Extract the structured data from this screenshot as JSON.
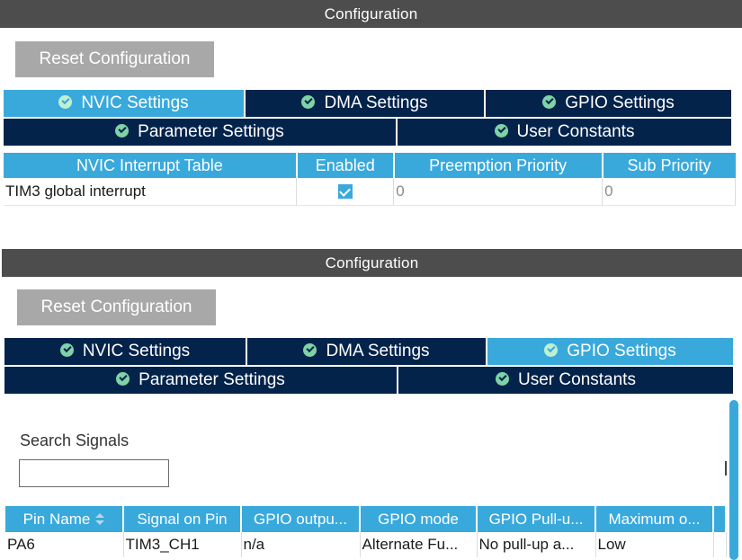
{
  "top_panel": {
    "title": "Configuration",
    "reset_label": "Reset Configuration",
    "tabs_row1": [
      {
        "label": "NVIC Settings",
        "active": true
      },
      {
        "label": "DMA Settings",
        "active": false
      },
      {
        "label": "GPIO Settings",
        "active": false
      }
    ],
    "tabs_row2": [
      {
        "label": "Parameter Settings"
      },
      {
        "label": "User Constants"
      }
    ],
    "nvic_table": {
      "headers": [
        "NVIC Interrupt Table",
        "Enabled",
        "Preemption Priority",
        "Sub Priority"
      ],
      "rows": [
        {
          "name": "TIM3 global interrupt",
          "enabled": true,
          "preemption": "0",
          "sub": "0"
        }
      ]
    }
  },
  "bottom_panel": {
    "title": "Configuration",
    "reset_label": "Reset Configuration",
    "tabs_row1": [
      {
        "label": "NVIC Settings",
        "active": false
      },
      {
        "label": "DMA Settings",
        "active": false
      },
      {
        "label": "GPIO Settings",
        "active": true
      }
    ],
    "tabs_row2": [
      {
        "label": "Parameter Settings"
      },
      {
        "label": "User Constants"
      }
    ],
    "search": {
      "label": "Search Signals",
      "value": ""
    },
    "gpio_table": {
      "headers": [
        "Pin Name",
        "Signal on Pin",
        "GPIO outpu...",
        "GPIO mode",
        "GPIO Pull-u...",
        "Maximum o..."
      ],
      "rows": [
        [
          "PA6",
          "TIM3_CH1",
          "n/a",
          "Alternate Fu...",
          "No pull-up a...",
          "Low"
        ]
      ]
    }
  },
  "colors": {
    "title_bar": "#4d4d4d",
    "tab_dark": "#03234b",
    "tab_active": "#39a9dc",
    "reset_button": "#a8a8a8"
  }
}
